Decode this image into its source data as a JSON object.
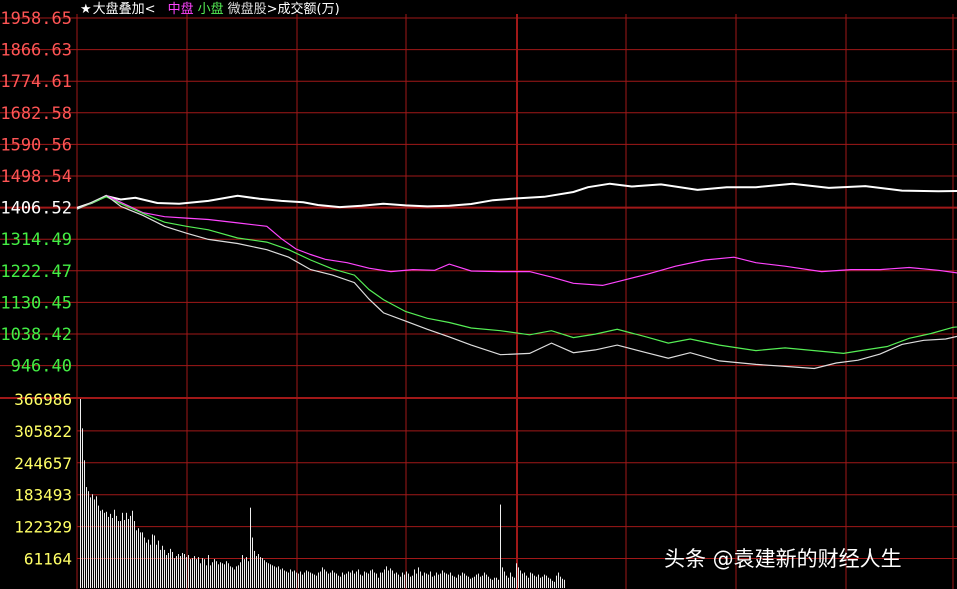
{
  "header": {
    "star": "★",
    "title": "大盘叠加<",
    "items": [
      {
        "label": "中盘",
        "color": "#ff44ff"
      },
      {
        "label": "小盘",
        "color": "#55ee55"
      },
      {
        "label": "微盘股",
        "color": "#dddddd"
      }
    ],
    "volume_label": ">成交额(万)"
  },
  "watermark": "头条 @袁建新的财经人生",
  "chart_data": {
    "type": "line",
    "price_axis": {
      "ticks": [
        "1958.65",
        "1866.63",
        "1774.61",
        "1682.58",
        "1590.56",
        "1498.54",
        "1406.52",
        "1314.49",
        "1222.47",
        "1130.45",
        "1038.42",
        "946.40"
      ],
      "red_ticks_count": 6,
      "base_index": 6,
      "range": [
        946.4,
        1958.65
      ]
    },
    "volume_axis": {
      "ticks": [
        "366986",
        "305822",
        "244657",
        "183493",
        "122329",
        "61164"
      ],
      "range": [
        0,
        366986
      ]
    },
    "colors": {
      "grid": "#a01818",
      "up": "#ff5555",
      "base": "#ffffff",
      "down": "#44ee44",
      "volume_label": "#ffff66",
      "volume_bar": "#eeeeee"
    },
    "total_points": 240,
    "series": [
      {
        "name": "大盘",
        "color": "#ffffff",
        "points": [
          [
            0,
            1406
          ],
          [
            4,
            1420
          ],
          [
            8,
            1440
          ],
          [
            12,
            1430
          ],
          [
            16,
            1435
          ],
          [
            22,
            1420
          ],
          [
            28,
            1418
          ],
          [
            36,
            1426
          ],
          [
            44,
            1441
          ],
          [
            50,
            1432
          ],
          [
            56,
            1426
          ],
          [
            62,
            1422
          ],
          [
            66,
            1414
          ],
          [
            72,
            1408
          ],
          [
            78,
            1412
          ],
          [
            84,
            1418
          ],
          [
            90,
            1413
          ],
          [
            96,
            1410
          ],
          [
            102,
            1412
          ],
          [
            108,
            1417
          ],
          [
            114,
            1428
          ],
          [
            120,
            1433
          ],
          [
            128,
            1438
          ],
          [
            136,
            1452
          ],
          [
            140,
            1466
          ],
          [
            146,
            1476
          ],
          [
            152,
            1468
          ],
          [
            160,
            1474
          ],
          [
            170,
            1458
          ],
          [
            178,
            1466
          ],
          [
            186,
            1466
          ],
          [
            196,
            1476
          ],
          [
            206,
            1464
          ],
          [
            216,
            1469
          ],
          [
            226,
            1456
          ],
          [
            236,
            1454
          ],
          [
            246,
            1456
          ],
          [
            256,
            1466
          ],
          [
            262,
            1476
          ],
          [
            266,
            1474
          ]
        ]
      },
      {
        "name": "中盘",
        "color": "#ff44ff",
        "points": [
          [
            0,
            1402
          ],
          [
            4,
            1420
          ],
          [
            8,
            1442
          ],
          [
            12,
            1422
          ],
          [
            18,
            1392
          ],
          [
            24,
            1380
          ],
          [
            30,
            1376
          ],
          [
            36,
            1372
          ],
          [
            44,
            1362
          ],
          [
            52,
            1352
          ],
          [
            56,
            1316
          ],
          [
            60,
            1286
          ],
          [
            64,
            1270
          ],
          [
            68,
            1256
          ],
          [
            74,
            1246
          ],
          [
            80,
            1230
          ],
          [
            86,
            1220
          ],
          [
            92,
            1226
          ],
          [
            98,
            1224
          ],
          [
            102,
            1242
          ],
          [
            108,
            1222
          ],
          [
            116,
            1220
          ],
          [
            124,
            1220
          ],
          [
            130,
            1204
          ],
          [
            136,
            1186
          ],
          [
            144,
            1180
          ],
          [
            150,
            1196
          ],
          [
            156,
            1212
          ],
          [
            164,
            1236
          ],
          [
            172,
            1254
          ],
          [
            180,
            1262
          ],
          [
            186,
            1246
          ],
          [
            194,
            1236
          ],
          [
            204,
            1220
          ],
          [
            212,
            1226
          ],
          [
            220,
            1226
          ],
          [
            228,
            1232
          ],
          [
            236,
            1224
          ],
          [
            244,
            1212
          ],
          [
            252,
            1206
          ],
          [
            260,
            1196
          ],
          [
            266,
            1194
          ],
          [
            274,
            1196
          ],
          [
            282,
            1192
          ],
          [
            290,
            1176
          ],
          [
            300,
            1186
          ],
          [
            306,
            1186
          ],
          [
            316,
            1168
          ],
          [
            322,
            1176
          ],
          [
            326,
            1182
          ],
          [
            330,
            1196
          ],
          [
            336,
            1206
          ],
          [
            342,
            1200
          ],
          [
            346,
            1192
          ]
        ]
      },
      {
        "name": "小盘",
        "color": "#55ee55",
        "points": [
          [
            0,
            1402
          ],
          [
            4,
            1420
          ],
          [
            8,
            1438
          ],
          [
            12,
            1418
          ],
          [
            18,
            1390
          ],
          [
            24,
            1364
          ],
          [
            30,
            1352
          ],
          [
            36,
            1342
          ],
          [
            44,
            1318
          ],
          [
            52,
            1306
          ],
          [
            58,
            1284
          ],
          [
            64,
            1254
          ],
          [
            70,
            1228
          ],
          [
            76,
            1210
          ],
          [
            80,
            1168
          ],
          [
            84,
            1138
          ],
          [
            90,
            1104
          ],
          [
            96,
            1084
          ],
          [
            102,
            1072
          ],
          [
            108,
            1056
          ],
          [
            116,
            1048
          ],
          [
            124,
            1036
          ],
          [
            130,
            1048
          ],
          [
            136,
            1028
          ],
          [
            142,
            1038
          ],
          [
            148,
            1052
          ],
          [
            156,
            1030
          ],
          [
            162,
            1012
          ],
          [
            168,
            1024
          ],
          [
            176,
            1006
          ],
          [
            186,
            990
          ],
          [
            194,
            998
          ],
          [
            202,
            990
          ],
          [
            210,
            982
          ],
          [
            216,
            992
          ],
          [
            222,
            1002
          ],
          [
            228,
            1026
          ],
          [
            234,
            1040
          ],
          [
            240,
            1058
          ],
          [
            248,
            1066
          ],
          [
            254,
            1074
          ],
          [
            260,
            1076
          ],
          [
            266,
            1070
          ],
          [
            272,
            1064
          ],
          [
            278,
            1058
          ],
          [
            284,
            1054
          ],
          [
            288,
            1034
          ],
          [
            296,
            1020
          ],
          [
            302,
            1016
          ],
          [
            308,
            1020
          ],
          [
            316,
            1024
          ],
          [
            324,
            1024
          ],
          [
            332,
            1024
          ],
          [
            340,
            1024
          ],
          [
            348,
            1026
          ],
          [
            356,
            1018
          ],
          [
            364,
            1008
          ],
          [
            372,
            996
          ],
          [
            380,
            984
          ],
          [
            386,
            976
          ],
          [
            396,
            968
          ],
          [
            406,
            962
          ],
          [
            416,
            958
          ],
          [
            428,
            960
          ],
          [
            436,
            954
          ],
          [
            446,
            928
          ],
          [
            452,
            932
          ],
          [
            458,
            946
          ],
          [
            464,
            956
          ],
          [
            470,
            942
          ],
          [
            476,
            946
          ]
        ]
      },
      {
        "name": "微盘股",
        "color": "#dddddd",
        "points": [
          [
            0,
            1402
          ],
          [
            4,
            1422
          ],
          [
            8,
            1442
          ],
          [
            12,
            1410
          ],
          [
            18,
            1384
          ],
          [
            24,
            1352
          ],
          [
            30,
            1332
          ],
          [
            36,
            1314
          ],
          [
            44,
            1302
          ],
          [
            52,
            1284
          ],
          [
            58,
            1262
          ],
          [
            64,
            1226
          ],
          [
            70,
            1210
          ],
          [
            76,
            1188
          ],
          [
            80,
            1140
          ],
          [
            84,
            1100
          ],
          [
            90,
            1076
          ],
          [
            96,
            1052
          ],
          [
            102,
            1030
          ],
          [
            108,
            1006
          ],
          [
            116,
            978
          ],
          [
            124,
            982
          ],
          [
            130,
            1012
          ],
          [
            136,
            984
          ],
          [
            142,
            992
          ],
          [
            148,
            1006
          ],
          [
            156,
            984
          ],
          [
            162,
            968
          ],
          [
            168,
            984
          ],
          [
            176,
            960
          ],
          [
            186,
            950
          ],
          [
            194,
            944
          ],
          [
            202,
            938
          ],
          [
            208,
            954
          ],
          [
            214,
            962
          ],
          [
            220,
            980
          ],
          [
            226,
            1008
          ],
          [
            232,
            1020
          ],
          [
            238,
            1024
          ],
          [
            246,
            1044
          ],
          [
            254,
            1048
          ],
          [
            260,
            1042
          ],
          [
            266,
            1040
          ],
          [
            272,
            1034
          ],
          [
            278,
            1024
          ],
          [
            284,
            1010
          ],
          [
            290,
            986
          ],
          [
            296,
            976
          ],
          [
            304,
            976
          ],
          [
            312,
            984
          ],
          [
            320,
            980
          ],
          [
            328,
            978
          ],
          [
            336,
            982
          ],
          [
            344,
            978
          ],
          [
            350,
            970
          ],
          [
            356,
            958
          ],
          [
            364,
            948
          ],
          [
            370,
            942
          ],
          [
            376,
            932
          ],
          [
            382,
            922
          ],
          [
            390,
            916
          ],
          [
            400,
            912
          ],
          [
            410,
            908
          ],
          [
            418,
            908
          ],
          [
            426,
            900
          ],
          [
            432,
            892
          ],
          [
            440,
            876
          ],
          [
            446,
            872
          ],
          [
            452,
            880
          ],
          [
            458,
            892
          ],
          [
            464,
            896
          ],
          [
            470,
            892
          ]
        ]
      }
    ],
    "volume": [
      366986,
      310000,
      248000,
      196000,
      188000,
      176000,
      182000,
      172000,
      178000,
      160000,
      150000,
      152000,
      146000,
      148000,
      138000,
      144000,
      136000,
      152000,
      140000,
      130000,
      130000,
      146000,
      132000,
      146000,
      134000,
      140000,
      150000,
      130000,
      112000,
      116000,
      108000,
      108000,
      98000,
      88000,
      94000,
      84000,
      104000,
      102000,
      84000,
      92000,
      74000,
      82000,
      74000,
      64000,
      68000,
      76000,
      70000,
      58000,
      62000,
      66000,
      62000,
      68000,
      66000,
      60000,
      64000,
      56000,
      58000,
      62000,
      56000,
      60000,
      48000,
      58000,
      56000,
      44000,
      64000,
      44000,
      50000,
      56000,
      52000,
      46000,
      50000,
      48000,
      46000,
      52000,
      48000,
      42000,
      40000,
      36000,
      42000,
      44000,
      50000,
      64000,
      56000,
      60000,
      52000,
      156000,
      98000,
      72000,
      62000,
      66000,
      60000,
      58000,
      54000,
      50000,
      48000,
      46000,
      44000,
      42000,
      40000,
      42000,
      36000,
      38000,
      34000,
      32000,
      30000,
      36000,
      32000,
      34000,
      30000,
      28000,
      32000,
      26000,
      30000,
      34000,
      32000,
      30000,
      28000,
      26000,
      24000,
      30000,
      32000,
      40000,
      36000,
      32000,
      28000,
      30000,
      34000,
      30000,
      28000,
      24000,
      22000,
      30000,
      26000,
      28000,
      32000,
      30000,
      34000,
      28000,
      32000,
      36000,
      26000,
      24000,
      32000,
      30000,
      28000,
      34000,
      36000,
      30000,
      28000,
      20000,
      30000,
      30000,
      36000,
      42000,
      34000,
      38000,
      34000,
      28000,
      30000,
      26000,
      22000,
      30000,
      26000,
      32000,
      28000,
      22000,
      24000,
      36000,
      28000,
      40000,
      32000,
      24000,
      30000,
      28000,
      26000,
      32000,
      22000,
      24000,
      30000,
      26000,
      28000,
      34000,
      30000,
      28000,
      26000,
      30000,
      24000,
      22000,
      20000,
      26000,
      24000,
      30000,
      28000,
      24000,
      22000,
      18000,
      20000,
      22000,
      26000,
      28000,
      22000,
      24000,
      30000,
      26000,
      22000,
      18000,
      16000,
      20000,
      20000,
      16000,
      162000,
      40000,
      32000,
      24000,
      20000,
      30000,
      22000,
      20000,
      48000,
      40000,
      34000,
      28000,
      30000,
      24000,
      20000,
      30000,
      28000,
      24000,
      22000,
      26000,
      20000,
      22000,
      26000,
      24000,
      20000,
      18000,
      14000,
      12000,
      24000,
      30000,
      22000,
      18000,
      16000
    ]
  }
}
